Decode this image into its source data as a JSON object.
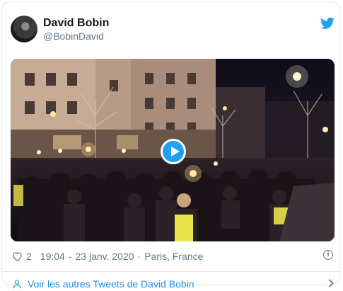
{
  "tweet": {
    "author_name": "David Bobin",
    "author_handle": "@BobinDavid",
    "likes": "2",
    "time": "19:04",
    "separator": "-",
    "date": "23 janv. 2020",
    "dot": "·",
    "location": "Paris, France",
    "more_tweets_label": "Voir les autres Tweets de David Bobin"
  },
  "icons": {
    "bird": "twitter-bird-icon",
    "heart": "heart-icon",
    "info": "info-icon",
    "person": "person-icon",
    "chevron": "chevron-right-icon",
    "play": "play-icon"
  },
  "colors": {
    "brand_blue": "#1da1f2",
    "link_blue": "#1b95e0",
    "muted": "#657786"
  }
}
